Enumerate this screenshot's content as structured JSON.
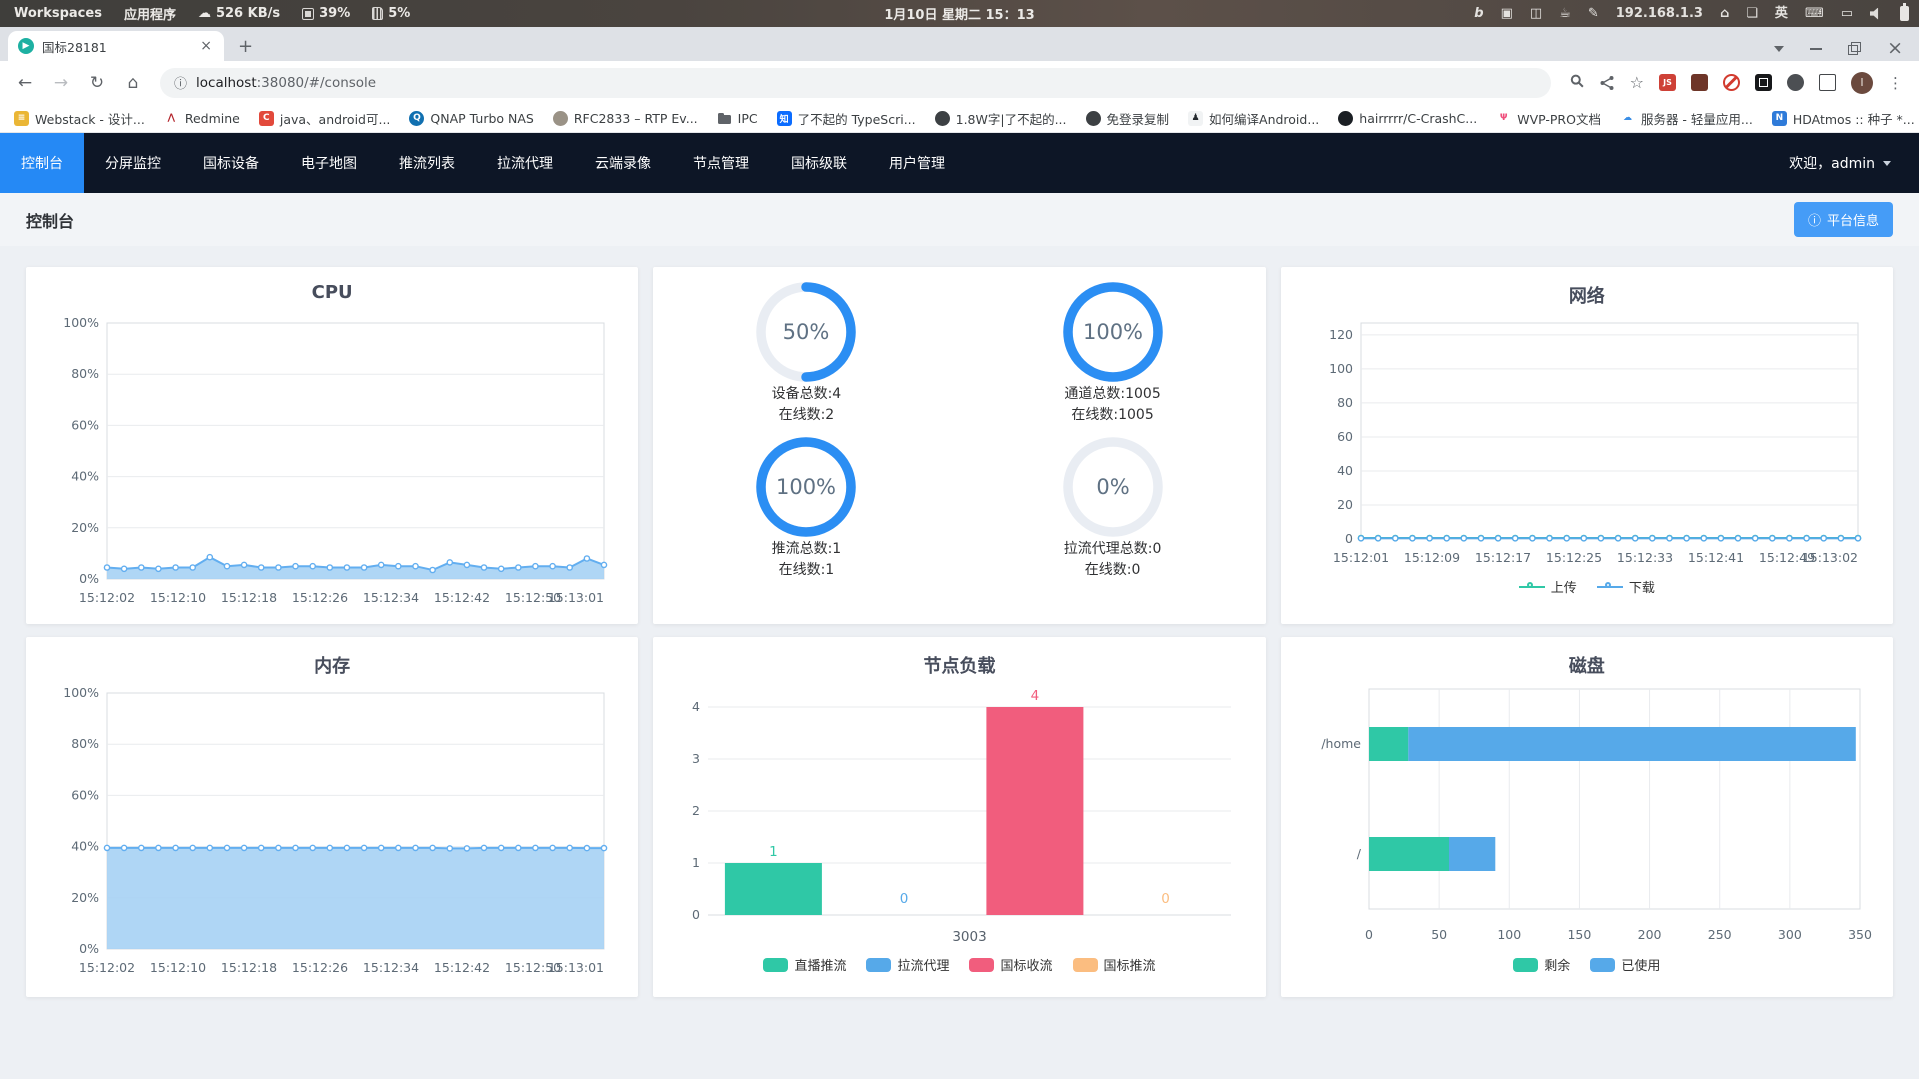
{
  "system_bar": {
    "workspaces": "Workspaces",
    "applications": "应用程序",
    "net_speed": "526 KB/s",
    "cpu": "39%",
    "mem": "5%",
    "datetime": "1月10日 星期二 15：13",
    "ip": "192.168.1.3",
    "ime": "英"
  },
  "browser": {
    "tab_title": "国标28181",
    "url_host": "localhost",
    "url_rest": ":38080/#/console",
    "avatar_letter": "I",
    "overflow_chevron": "»",
    "bookmarks": [
      {
        "label": "Webstack - 设计...",
        "bg": "#eab636",
        "fg": "#ffffff",
        "glyph": "≡",
        "shape": "square"
      },
      {
        "label": "Redmine",
        "bg": "#ffffff",
        "fg": "#b3242b",
        "glyph": "⋀",
        "shape": "square"
      },
      {
        "label": "java、android可...",
        "bg": "#e2493b",
        "fg": "#ffffff",
        "glyph": "C",
        "shape": "square"
      },
      {
        "label": "QNAP Turbo NAS",
        "bg": "#1170b0",
        "fg": "#ffffff",
        "glyph": "Q",
        "shape": "circle"
      },
      {
        "label": "RFC2833 – RTP Ev...",
        "bg": "#9a9286",
        "fg": "#ffffff",
        "glyph": "",
        "shape": "circle"
      },
      {
        "label": "IPC",
        "bg": "#5f6368",
        "fg": "#ffffff",
        "glyph": "",
        "shape": "folder"
      },
      {
        "label": "了不起的 TypeScri...",
        "bg": "#0b6cff",
        "fg": "#ffffff",
        "glyph": "知",
        "shape": "square"
      },
      {
        "label": "1.8W字|了不起的...",
        "bg": "#3c4043",
        "fg": "#e8eaed",
        "glyph": "",
        "shape": "circle"
      },
      {
        "label": "免登录复制",
        "bg": "#3c4043",
        "fg": "#e8eaed",
        "glyph": "",
        "shape": "circle"
      },
      {
        "label": "如何编译Android...",
        "bg": "#f1f3f4",
        "fg": "#23282d",
        "glyph": "♟",
        "shape": "square"
      },
      {
        "label": "hairrrrr/C-CrashC...",
        "bg": "#1b1f24",
        "fg": "#ffffff",
        "glyph": "",
        "shape": "circle"
      },
      {
        "label": "WVP-PRO文档",
        "bg": "#ffffff",
        "fg": "#ef4f7c",
        "glyph": "Ψ",
        "shape": "square"
      },
      {
        "label": "服务器 - 轻量应用...",
        "bg": "#ffffff",
        "fg": "#3a8ee6",
        "glyph": "☁",
        "shape": "square"
      },
      {
        "label": "HDAtmos :: 种子 *...",
        "bg": "#2f7bd9",
        "fg": "#ffffff",
        "glyph": "N",
        "shape": "square"
      }
    ]
  },
  "navbar": {
    "tabs": [
      "控制台",
      "分屏监控",
      "国标设备",
      "电子地图",
      "推流列表",
      "拉流代理",
      "云端录像",
      "节点管理",
      "国标级联",
      "用户管理"
    ],
    "active_index": 0,
    "welcome": "欢迎，admin"
  },
  "page": {
    "title": "控制台",
    "platform_info_button": "平台信息",
    "info_icon": "ⓘ"
  },
  "chart_data": [
    {
      "id": "cpu",
      "type": "area",
      "title": "CPU",
      "x": [
        "15:12:02",
        "15:12:10",
        "15:12:18",
        "15:12:26",
        "15:12:34",
        "15:12:42",
        "15:12:50",
        "15:13:01"
      ],
      "ylim": [
        0,
        100
      ],
      "yticks": [
        0,
        20,
        40,
        60,
        80,
        100
      ],
      "ysuffix": "%",
      "plot_max": 100,
      "grid": true,
      "series": [
        {
          "name": "CPU",
          "color": "#62aef0",
          "fill": "#a6d2f4",
          "values": [
            4.5,
            4,
            4.5,
            4,
            4.5,
            4.5,
            8.5,
            5,
            5.5,
            4.5,
            4.5,
            5,
            5,
            4.5,
            4.5,
            4.5,
            5.5,
            5,
            5,
            3.5,
            6.5,
            5.5,
            4.5,
            4,
            4.5,
            5,
            5,
            4.5,
            8,
            5.5
          ]
        }
      ]
    },
    {
      "id": "rings",
      "type": "donut",
      "ring_color": "#2b8ef3",
      "track_color": "#e9edf3",
      "items": [
        {
          "percent": 50,
          "percent_label": "50%",
          "line1": "设备总数:4",
          "line2": "在线数:2"
        },
        {
          "percent": 100,
          "percent_label": "100%",
          "line1": "通道总数:1005",
          "line2": "在线数:1005"
        },
        {
          "percent": 100,
          "percent_label": "100%",
          "line1": "推流总数:1",
          "line2": "在线数:1"
        },
        {
          "percent": 0,
          "percent_label": "0%",
          "line1": "拉流代理总数:0",
          "line2": "在线数:0"
        }
      ]
    },
    {
      "id": "network",
      "type": "line",
      "title": "网络",
      "x": [
        "15:12:01",
        "15:12:09",
        "15:12:17",
        "15:12:25",
        "15:12:33",
        "15:12:41",
        "15:12:49",
        "15:13:02"
      ],
      "ylim": [
        0,
        120
      ],
      "yticks": [
        0,
        20,
        40,
        60,
        80,
        100,
        120
      ],
      "ysuffix": "",
      "plot_max": 127,
      "grid": true,
      "legend_position": "bottom",
      "series": [
        {
          "name": "上传",
          "color": "#2fc8a6",
          "fill": null,
          "values": [
            0.6,
            0.6,
            0.6,
            0.6,
            0.6,
            0.6,
            0.6,
            0.6,
            0.6,
            0.6,
            0.6,
            0.6,
            0.6,
            0.6,
            0.6,
            0.6,
            0.6,
            0.6,
            0.6,
            0.6,
            0.6,
            0.6,
            0.6,
            0.6,
            0.6,
            0.6,
            0.6,
            0.6,
            0.6,
            0.6
          ]
        },
        {
          "name": "下载",
          "color": "#56a9e9",
          "fill": null,
          "values": [
            0.4,
            0.4,
            0.4,
            0.4,
            0.4,
            0.4,
            0.4,
            0.4,
            0.4,
            0.4,
            0.4,
            0.4,
            0.4,
            0.4,
            0.4,
            0.4,
            0.4,
            0.4,
            0.4,
            0.4,
            0.4,
            0.4,
            0.4,
            0.4,
            0.4,
            0.4,
            0.4,
            0.4,
            0.4,
            0.4
          ]
        }
      ]
    },
    {
      "id": "memory",
      "type": "area",
      "title": "内存",
      "x": [
        "15:12:02",
        "15:12:10",
        "15:12:18",
        "15:12:26",
        "15:12:34",
        "15:12:42",
        "15:12:50",
        "15:13:01"
      ],
      "ylim": [
        0,
        100
      ],
      "yticks": [
        0,
        20,
        40,
        60,
        80,
        100
      ],
      "ysuffix": "%",
      "plot_max": 100,
      "grid": true,
      "series": [
        {
          "name": "内存",
          "color": "#62aef0",
          "fill": "#a6d2f4",
          "values": [
            39.5,
            39.5,
            39.5,
            39.5,
            39.5,
            39.5,
            39.5,
            39.5,
            39.5,
            39.5,
            39.5,
            39.5,
            39.5,
            39.5,
            39.5,
            39.5,
            39.5,
            39.5,
            39.5,
            39.5,
            39.3,
            39.3,
            39.5,
            39.5,
            39.5,
            39.5,
            39.5,
            39.5,
            39.4,
            39.4
          ]
        }
      ]
    },
    {
      "id": "nodeload",
      "type": "bar",
      "title": "节点负载",
      "category": "3003",
      "ylim": [
        0,
        4
      ],
      "yticks": [
        0,
        1,
        2,
        3,
        4
      ],
      "grid": true,
      "legend_position": "bottom",
      "series": [
        {
          "name": "直播推流",
          "color": "#2fc8a6",
          "value": 1
        },
        {
          "name": "拉流代理",
          "color": "#56a9e9",
          "value": 0
        },
        {
          "name": "国标收流",
          "color": "#f15d7d",
          "value": 4
        },
        {
          "name": "国标推流",
          "color": "#fbbd80",
          "value": 0
        }
      ]
    },
    {
      "id": "disk",
      "type": "hbar-stacked",
      "title": "磁盘",
      "categories": [
        "/home",
        "/"
      ],
      "xlim": [
        0,
        350
      ],
      "xticks": [
        0,
        50,
        100,
        150,
        200,
        250,
        300,
        350
      ],
      "grid": true,
      "legend_position": "bottom",
      "series": [
        {
          "name": "剩余",
          "color": "#2fc8a6",
          "values": [
            28,
            57
          ]
        },
        {
          "name": "已使用",
          "color": "#56a9e9",
          "values": [
            319,
            33
          ]
        }
      ]
    }
  ]
}
